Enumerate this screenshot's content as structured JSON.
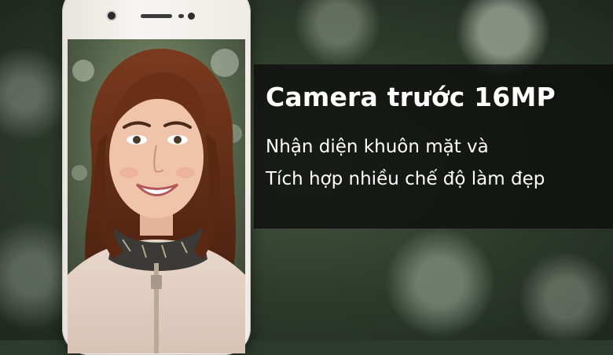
{
  "banner": {
    "title": "Camera trước 16MP",
    "line1": "Nhận diện khuôn mặt và",
    "line2": "Tích hợp nhiều chế độ làm đẹp"
  },
  "colors": {
    "banner_bg": "#0c0c0c",
    "text": "#ffffff",
    "phone_body": "#f3f0ec"
  }
}
